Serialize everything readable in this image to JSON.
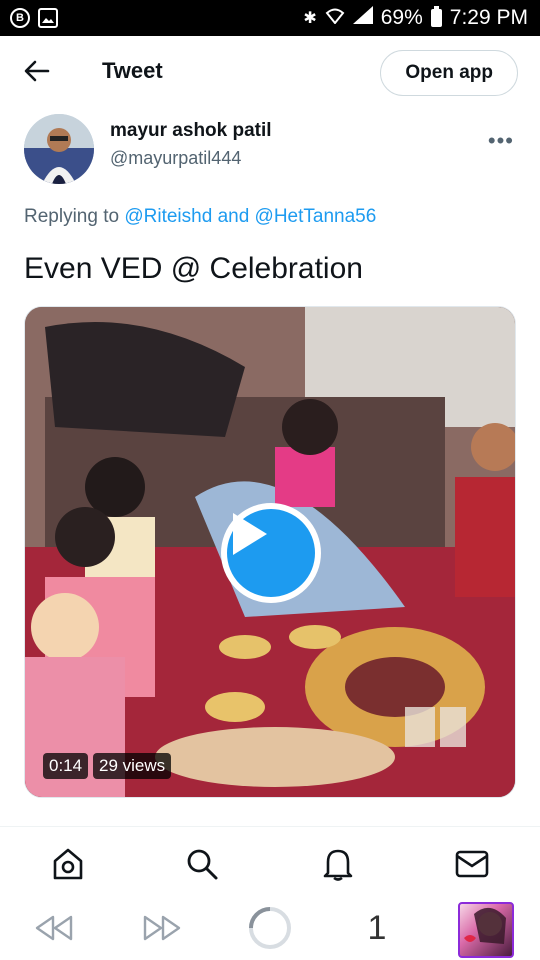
{
  "status_bar": {
    "left_icons": [
      "B",
      "image-icon"
    ],
    "battery": "69%",
    "time": "7:29 PM"
  },
  "header": {
    "title": "Tweet",
    "open_app": "Open app"
  },
  "tweet": {
    "author_name": "mayur ashok patil",
    "author_handle": "@mayurpatil444",
    "replying_prefix": "Replying to",
    "reply_user1": "@Riteishd",
    "reply_and": "and",
    "reply_user2": "@HetTanna56",
    "text": "Even VED @ Celebration",
    "video": {
      "duration": "0:14",
      "views": "29 views"
    }
  },
  "bottom_nav": [
    "home-icon",
    "search-icon",
    "notifications-icon",
    "messages-icon"
  ],
  "browser_bar": {
    "tab_count": "1"
  }
}
